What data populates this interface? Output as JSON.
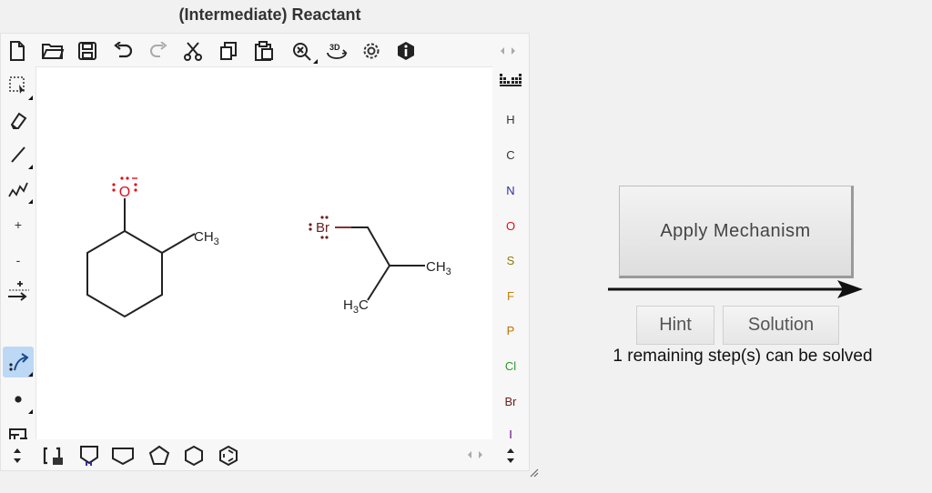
{
  "panel": {
    "title": "(Intermediate) Reactant"
  },
  "toolbar": {
    "top_icons": [
      "new-document-icon",
      "open-folder-icon",
      "save-icon",
      "undo-icon",
      "redo-icon",
      "cut-icon",
      "copy-icon",
      "paste-icon",
      "zoom-icon",
      "3d-icon",
      "settings-icon",
      "info-icon",
      "panel-arrows-icon"
    ],
    "left_icons": [
      "selection-icon",
      "eraser-icon",
      "single-bond-icon",
      "chain-icon",
      "positive-charge-icon",
      "negative-charge-icon",
      "lone-pair-charge-icon",
      "curved-arrow-icon",
      "radical-dot-icon",
      "rectangle-icon",
      "text-icon"
    ],
    "left_labels": {
      "plus": "+",
      "minus": "-"
    },
    "bottom_icons": [
      "scroll-arrows-icon",
      "bracket-icon",
      "template-icon",
      "cyclopentane-template-icon",
      "pentagon-icon",
      "hexagon-icon",
      "benzene-icon",
      "panel-arrows-icon",
      "scroll-arrows-icon"
    ]
  },
  "elements": [
    "H",
    "C",
    "N",
    "O",
    "S",
    "F",
    "P",
    "Cl",
    "Br",
    "I"
  ],
  "element_colors": {
    "H": "#333333",
    "C": "#333333",
    "N": "#2e2ea8",
    "O": "#e0101a",
    "S": "#8a7a10",
    "F": "#c08010",
    "P": "#c07000",
    "Cl": "#2a9a2a",
    "Br": "#6b2020",
    "I": "#6a0a8a"
  },
  "molecule1": {
    "oxygen": "O",
    "methyl": "CH",
    "methyl_sub": "3"
  },
  "molecule2": {
    "bromine": "Br",
    "methyl1": "CH",
    "methyl1_sub": "3",
    "methyl2_pre": "H",
    "methyl2_sub": "3",
    "methyl2_post": "C"
  },
  "actions": {
    "apply_label": "Apply Mechanism",
    "hint_label": "Hint",
    "solution_label": "Solution",
    "status_text": "1 remaining step(s) can be solved"
  }
}
